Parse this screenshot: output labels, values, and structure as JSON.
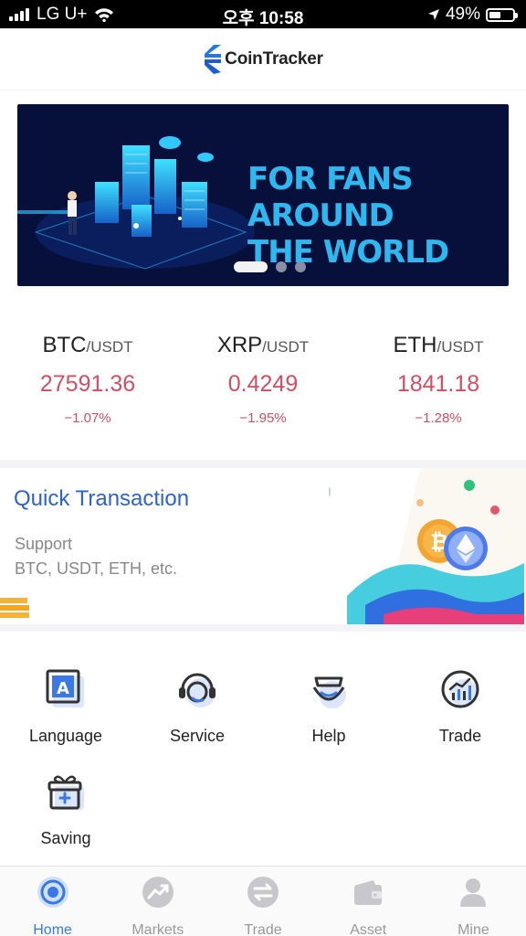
{
  "status_bar": {
    "carrier": "LG U+",
    "time": "오후 10:58",
    "battery": "49%",
    "battery_level": 0.49
  },
  "header": {
    "logo_text": "CoinTracker"
  },
  "banner": {
    "headline_line1": "FOR FANS AROUND",
    "headline_line2": "THE WORLD",
    "slide_count": 3,
    "active_slide": 1
  },
  "tickers": [
    {
      "base": "BTC",
      "quote": "/USDT",
      "price": "27591.36",
      "change": "−1.07%"
    },
    {
      "base": "XRP",
      "quote": "/USDT",
      "price": "0.4249",
      "change": "−1.95%"
    },
    {
      "base": "ETH",
      "quote": "/USDT",
      "price": "1841.18",
      "change": "−1.28%"
    }
  ],
  "quick_transaction": {
    "title": "Quick Transaction",
    "subtitle_line1": "Support",
    "subtitle_line2": "BTC, USDT, ETH, etc."
  },
  "features": [
    {
      "label": "Language",
      "icon": "language-icon"
    },
    {
      "label": "Service",
      "icon": "headset-icon"
    },
    {
      "label": "Help",
      "icon": "help-icon"
    },
    {
      "label": "Trade",
      "icon": "trade-chart-icon"
    },
    {
      "label": "Saving",
      "icon": "gift-icon"
    }
  ],
  "bottom_nav": [
    {
      "label": "Home",
      "icon": "home-icon",
      "active": true
    },
    {
      "label": "Markets",
      "icon": "markets-icon",
      "active": false
    },
    {
      "label": "Trade",
      "icon": "trade-icon",
      "active": false
    },
    {
      "label": "Asset",
      "icon": "wallet-icon",
      "active": false
    },
    {
      "label": "Mine",
      "icon": "user-icon",
      "active": false
    }
  ],
  "colors": {
    "accent": "#3a78e6",
    "negative": "#cf4f63",
    "title_blue": "#2f63c7",
    "banner_bg": "#07103a"
  }
}
